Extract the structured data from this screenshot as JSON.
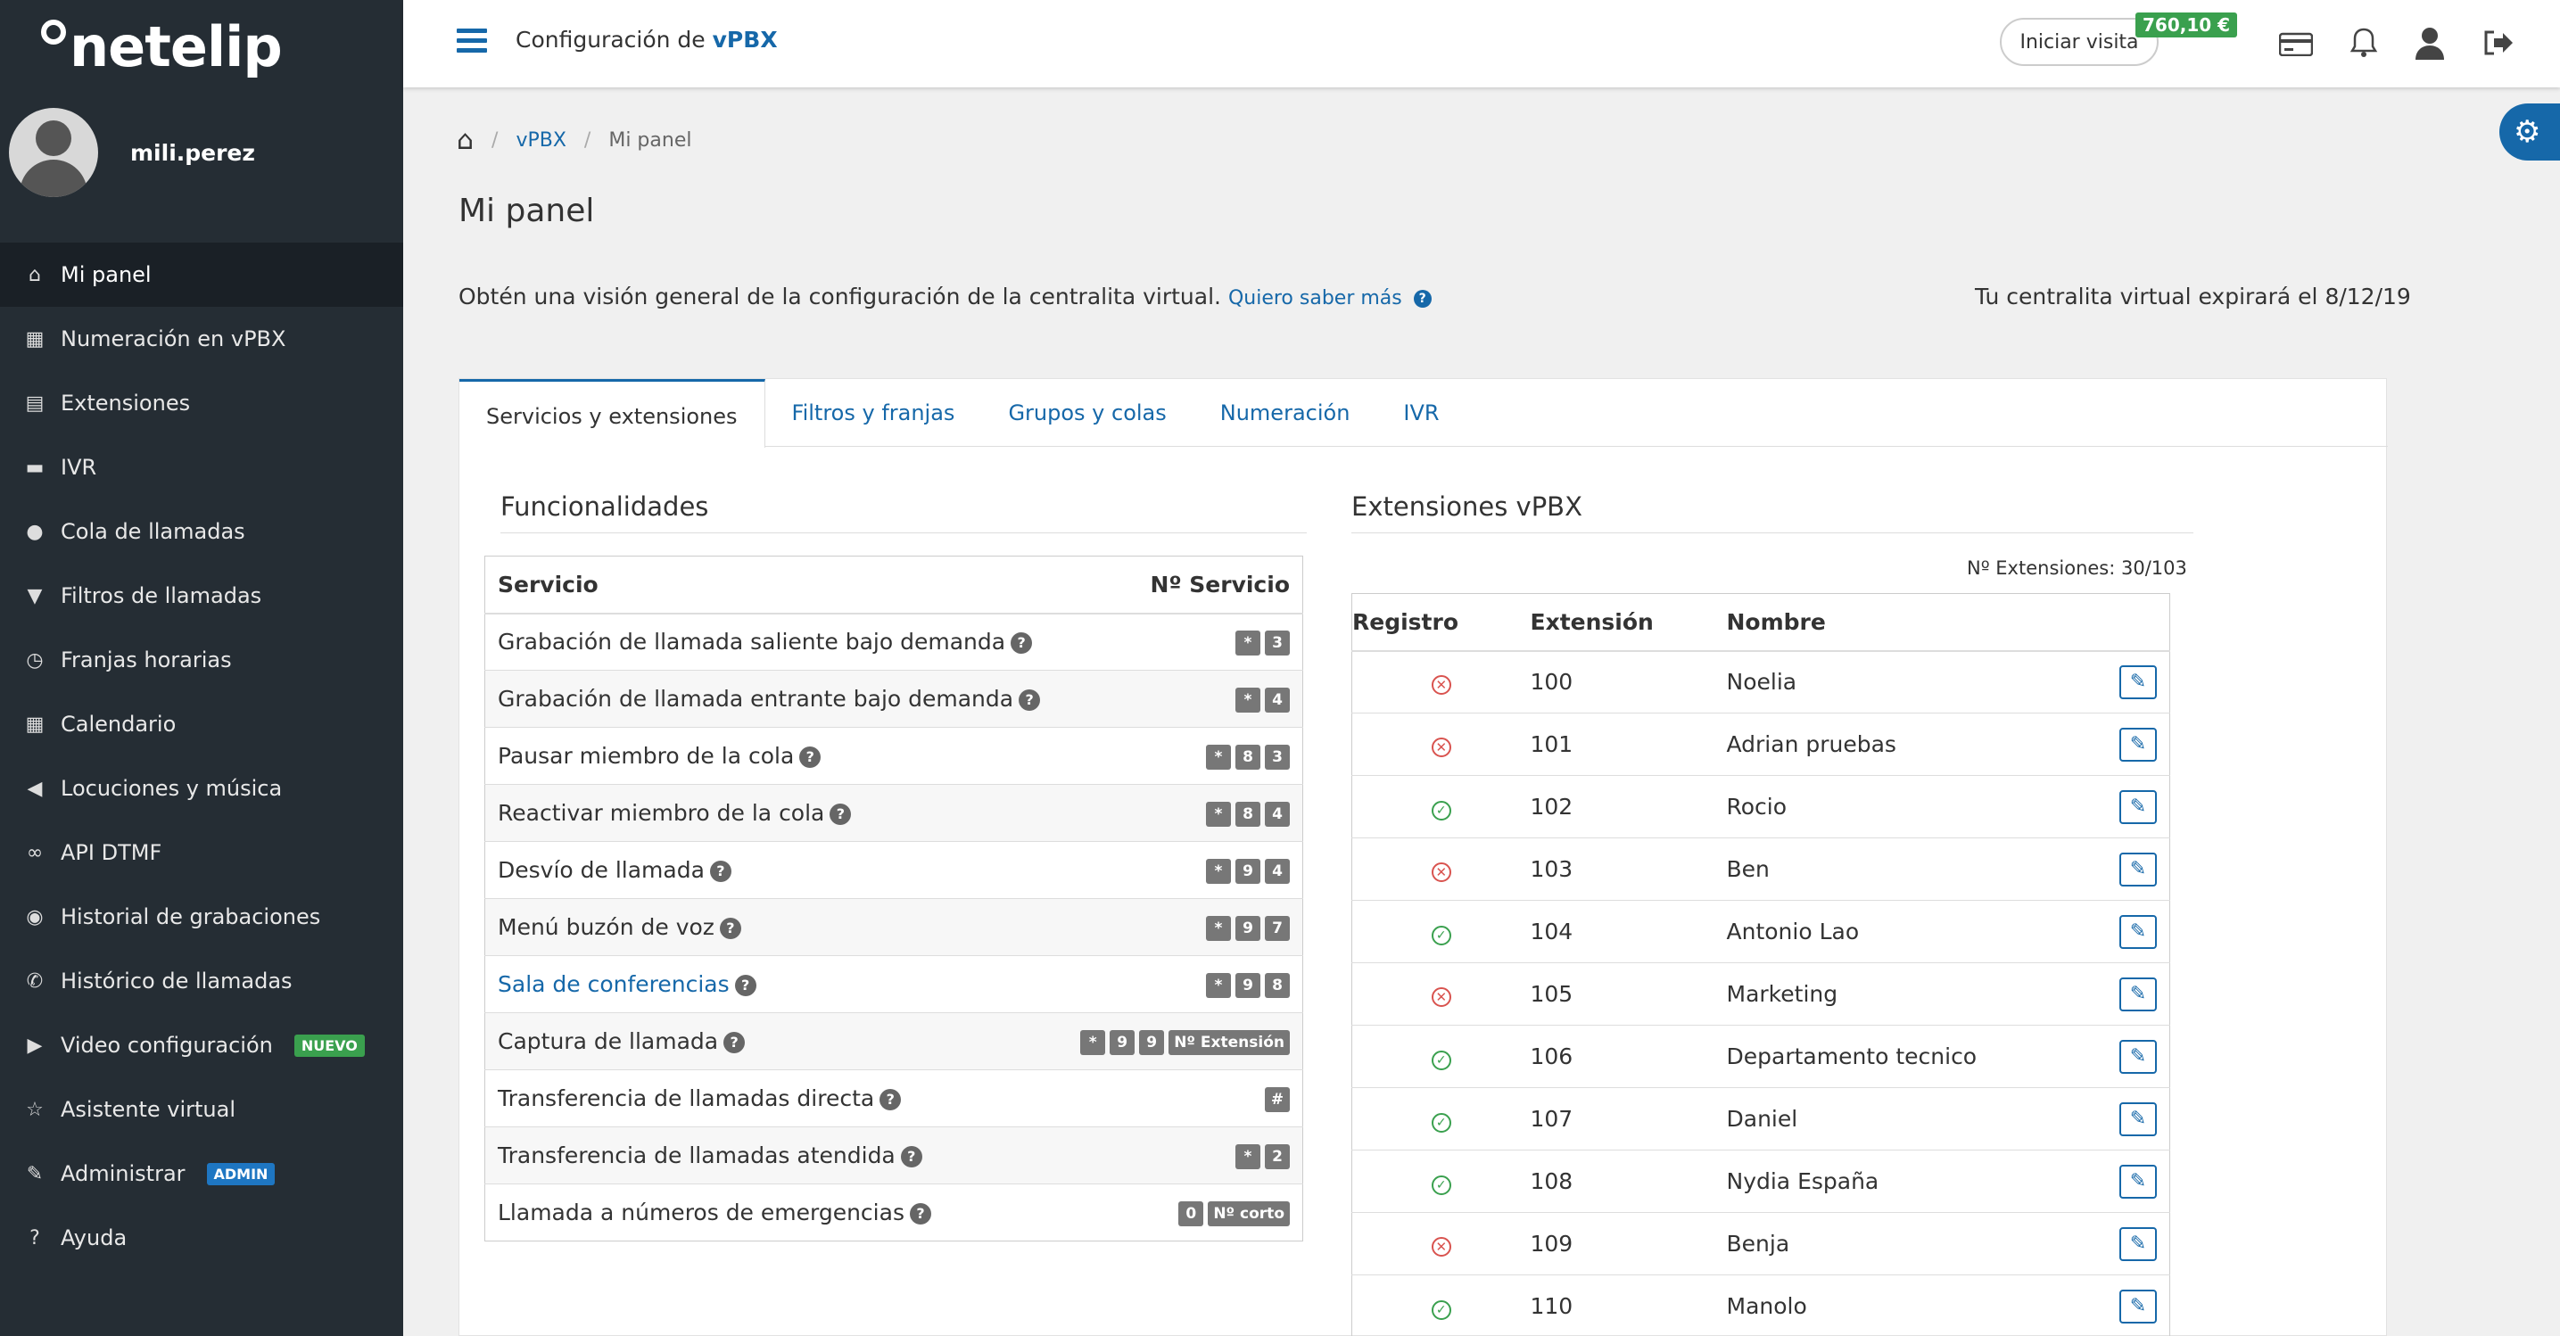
{
  "app": {
    "logo": "netelip",
    "username": "mili.perez"
  },
  "sidebar": {
    "items": [
      {
        "label": "Mi panel",
        "icon": "home-icon"
      },
      {
        "label": "Numeración en vPBX",
        "icon": "grid-icon"
      },
      {
        "label": "Extensiones",
        "icon": "list-icon"
      },
      {
        "label": "IVR",
        "icon": "chat-icon"
      },
      {
        "label": "Cola de llamadas",
        "icon": "user-icon"
      },
      {
        "label": "Filtros de llamadas",
        "icon": "filter-icon"
      },
      {
        "label": "Franjas horarias",
        "icon": "clock-icon"
      },
      {
        "label": "Calendario",
        "icon": "calendar-icon"
      },
      {
        "label": "Locuciones y música",
        "icon": "speaker-icon"
      },
      {
        "label": "API DTMF",
        "icon": "link-icon"
      },
      {
        "label": "Historial de grabaciones",
        "icon": "record-icon"
      },
      {
        "label": "Histórico de llamadas",
        "icon": "phone-icon"
      },
      {
        "label": "Video configuración",
        "icon": "video-icon",
        "badge": "NUEVO"
      },
      {
        "label": "Asistente virtual",
        "icon": "star-icon"
      },
      {
        "label": "Administrar",
        "icon": "edit-icon",
        "badge": "ADMIN"
      },
      {
        "label": "Ayuda",
        "icon": "help-icon"
      }
    ]
  },
  "header": {
    "title_prefix": "Configuración de",
    "title_brand": "vPBX",
    "visit_button": "Iniciar visita",
    "balance": "760,10 €"
  },
  "breadcrumb": {
    "level1": "vPBX",
    "current": "Mi panel"
  },
  "page": {
    "title": "Mi panel",
    "intro": "Obtén una visión general de la configuración de la centralita virtual.",
    "learn_more": "Quiero saber más",
    "expire": "Tu centralita virtual expirará el 8/12/19"
  },
  "tabs": [
    "Servicios y extensiones",
    "Filtros y franjas",
    "Grupos y colas",
    "Numeración",
    "IVR"
  ],
  "services": {
    "title": "Funcionalidades",
    "col_service": "Servicio",
    "col_number": "Nº Servicio",
    "rows": [
      {
        "name": "Grabación de llamada saliente bajo demanda",
        "keys": [
          "*",
          "3"
        ]
      },
      {
        "name": "Grabación de llamada entrante bajo demanda",
        "keys": [
          "*",
          "4"
        ]
      },
      {
        "name": "Pausar miembro de la cola",
        "keys": [
          "*",
          "8",
          "3"
        ]
      },
      {
        "name": "Reactivar miembro de la cola",
        "keys": [
          "*",
          "8",
          "4"
        ]
      },
      {
        "name": "Desvío de llamada",
        "keys": [
          "*",
          "9",
          "4"
        ]
      },
      {
        "name": "Menú buzón de voz",
        "keys": [
          "*",
          "9",
          "7"
        ]
      },
      {
        "name": "Sala de conferencias",
        "keys": [
          "*",
          "9",
          "8"
        ],
        "link": true
      },
      {
        "name": "Captura de llamada",
        "keys": [
          "*",
          "9",
          "9",
          "Nº Extensión"
        ]
      },
      {
        "name": "Transferencia de llamadas directa",
        "keys": [
          "#"
        ]
      },
      {
        "name": "Transferencia de llamadas atendida",
        "keys": [
          "*",
          "2"
        ]
      },
      {
        "name": "Llamada a números de emergencias",
        "keys": [
          "0",
          "Nº corto"
        ]
      }
    ]
  },
  "extensions": {
    "title": "Extensiones vPBX",
    "count": "Nº Extensiones: 30/103",
    "col_registro": "Registro",
    "col_extension": "Extensión",
    "col_nombre": "Nombre",
    "rows": [
      {
        "ext": "100",
        "name": "Noelia",
        "registered": false
      },
      {
        "ext": "101",
        "name": "Adrian pruebas",
        "registered": false
      },
      {
        "ext": "102",
        "name": "Rocio",
        "registered": true
      },
      {
        "ext": "103",
        "name": "Ben",
        "registered": false
      },
      {
        "ext": "104",
        "name": "Antonio Lao",
        "registered": true
      },
      {
        "ext": "105",
        "name": "Marketing",
        "registered": false
      },
      {
        "ext": "106",
        "name": "Departamento tecnico",
        "registered": true
      },
      {
        "ext": "107",
        "name": "Daniel",
        "registered": true
      },
      {
        "ext": "108",
        "name": "Nydia España",
        "registered": true
      },
      {
        "ext": "109",
        "name": "Benja",
        "registered": false
      },
      {
        "ext": "110",
        "name": "Manolo",
        "registered": true
      }
    ]
  },
  "colors": {
    "accent": "#1668a9",
    "sidebar": "#252d34",
    "success": "#3aa04e",
    "danger": "#d9534f"
  }
}
